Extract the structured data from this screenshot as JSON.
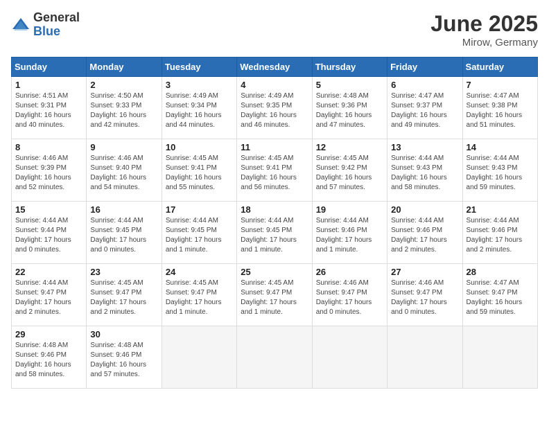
{
  "logo": {
    "general": "General",
    "blue": "Blue"
  },
  "title": "June 2025",
  "subtitle": "Mirow, Germany",
  "days_header": [
    "Sunday",
    "Monday",
    "Tuesday",
    "Wednesday",
    "Thursday",
    "Friday",
    "Saturday"
  ],
  "weeks": [
    [
      {
        "day": "1",
        "info": "Sunrise: 4:51 AM\nSunset: 9:31 PM\nDaylight: 16 hours\nand 40 minutes."
      },
      {
        "day": "2",
        "info": "Sunrise: 4:50 AM\nSunset: 9:33 PM\nDaylight: 16 hours\nand 42 minutes."
      },
      {
        "day": "3",
        "info": "Sunrise: 4:49 AM\nSunset: 9:34 PM\nDaylight: 16 hours\nand 44 minutes."
      },
      {
        "day": "4",
        "info": "Sunrise: 4:49 AM\nSunset: 9:35 PM\nDaylight: 16 hours\nand 46 minutes."
      },
      {
        "day": "5",
        "info": "Sunrise: 4:48 AM\nSunset: 9:36 PM\nDaylight: 16 hours\nand 47 minutes."
      },
      {
        "day": "6",
        "info": "Sunrise: 4:47 AM\nSunset: 9:37 PM\nDaylight: 16 hours\nand 49 minutes."
      },
      {
        "day": "7",
        "info": "Sunrise: 4:47 AM\nSunset: 9:38 PM\nDaylight: 16 hours\nand 51 minutes."
      }
    ],
    [
      {
        "day": "8",
        "info": "Sunrise: 4:46 AM\nSunset: 9:39 PM\nDaylight: 16 hours\nand 52 minutes."
      },
      {
        "day": "9",
        "info": "Sunrise: 4:46 AM\nSunset: 9:40 PM\nDaylight: 16 hours\nand 54 minutes."
      },
      {
        "day": "10",
        "info": "Sunrise: 4:45 AM\nSunset: 9:41 PM\nDaylight: 16 hours\nand 55 minutes."
      },
      {
        "day": "11",
        "info": "Sunrise: 4:45 AM\nSunset: 9:41 PM\nDaylight: 16 hours\nand 56 minutes."
      },
      {
        "day": "12",
        "info": "Sunrise: 4:45 AM\nSunset: 9:42 PM\nDaylight: 16 hours\nand 57 minutes."
      },
      {
        "day": "13",
        "info": "Sunrise: 4:44 AM\nSunset: 9:43 PM\nDaylight: 16 hours\nand 58 minutes."
      },
      {
        "day": "14",
        "info": "Sunrise: 4:44 AM\nSunset: 9:43 PM\nDaylight: 16 hours\nand 59 minutes."
      }
    ],
    [
      {
        "day": "15",
        "info": "Sunrise: 4:44 AM\nSunset: 9:44 PM\nDaylight: 17 hours\nand 0 minutes."
      },
      {
        "day": "16",
        "info": "Sunrise: 4:44 AM\nSunset: 9:45 PM\nDaylight: 17 hours\nand 0 minutes."
      },
      {
        "day": "17",
        "info": "Sunrise: 4:44 AM\nSunset: 9:45 PM\nDaylight: 17 hours\nand 1 minute."
      },
      {
        "day": "18",
        "info": "Sunrise: 4:44 AM\nSunset: 9:45 PM\nDaylight: 17 hours\nand 1 minute."
      },
      {
        "day": "19",
        "info": "Sunrise: 4:44 AM\nSunset: 9:46 PM\nDaylight: 17 hours\nand 1 minute."
      },
      {
        "day": "20",
        "info": "Sunrise: 4:44 AM\nSunset: 9:46 PM\nDaylight: 17 hours\nand 2 minutes."
      },
      {
        "day": "21",
        "info": "Sunrise: 4:44 AM\nSunset: 9:46 PM\nDaylight: 17 hours\nand 2 minutes."
      }
    ],
    [
      {
        "day": "22",
        "info": "Sunrise: 4:44 AM\nSunset: 9:47 PM\nDaylight: 17 hours\nand 2 minutes."
      },
      {
        "day": "23",
        "info": "Sunrise: 4:45 AM\nSunset: 9:47 PM\nDaylight: 17 hours\nand 2 minutes."
      },
      {
        "day": "24",
        "info": "Sunrise: 4:45 AM\nSunset: 9:47 PM\nDaylight: 17 hours\nand 1 minute."
      },
      {
        "day": "25",
        "info": "Sunrise: 4:45 AM\nSunset: 9:47 PM\nDaylight: 17 hours\nand 1 minute."
      },
      {
        "day": "26",
        "info": "Sunrise: 4:46 AM\nSunset: 9:47 PM\nDaylight: 17 hours\nand 0 minutes."
      },
      {
        "day": "27",
        "info": "Sunrise: 4:46 AM\nSunset: 9:47 PM\nDaylight: 17 hours\nand 0 minutes."
      },
      {
        "day": "28",
        "info": "Sunrise: 4:47 AM\nSunset: 9:47 PM\nDaylight: 16 hours\nand 59 minutes."
      }
    ],
    [
      {
        "day": "29",
        "info": "Sunrise: 4:48 AM\nSunset: 9:46 PM\nDaylight: 16 hours\nand 58 minutes."
      },
      {
        "day": "30",
        "info": "Sunrise: 4:48 AM\nSunset: 9:46 PM\nDaylight: 16 hours\nand 57 minutes."
      },
      {
        "day": "",
        "info": ""
      },
      {
        "day": "",
        "info": ""
      },
      {
        "day": "",
        "info": ""
      },
      {
        "day": "",
        "info": ""
      },
      {
        "day": "",
        "info": ""
      }
    ]
  ]
}
